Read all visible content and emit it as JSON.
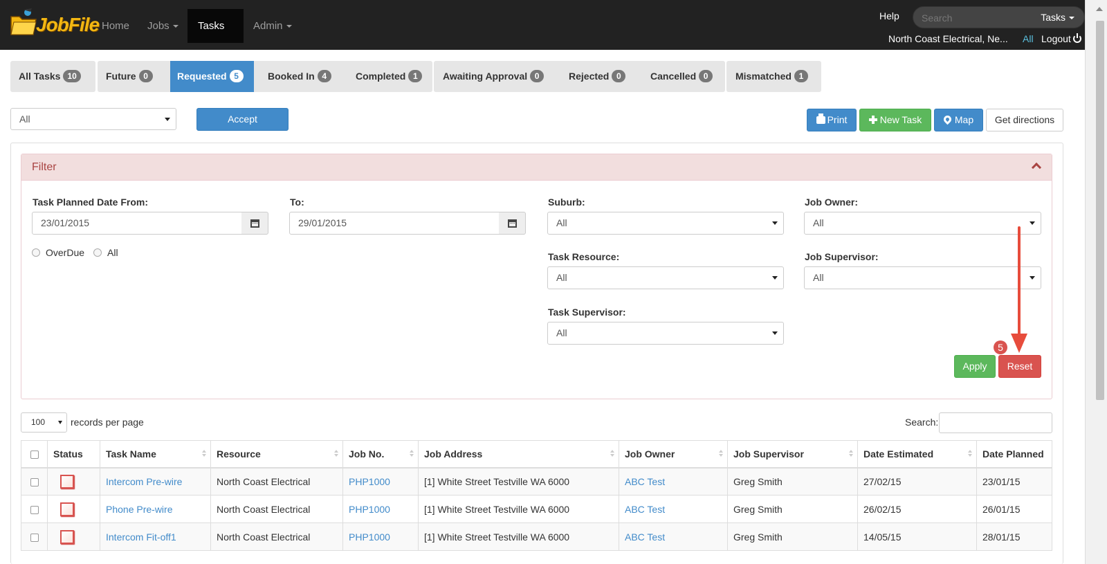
{
  "nav": {
    "brand": "JobFile",
    "items": [
      {
        "label": "Home"
      },
      {
        "label": "Jobs"
      },
      {
        "label": "Tasks"
      },
      {
        "label": "Admin"
      }
    ],
    "help": "Help",
    "search_placeholder": "Search",
    "search_scope": "Tasks",
    "company": "North Coast Electrical, Ne...",
    "all_link": "All",
    "logout": "Logout"
  },
  "tabs": [
    {
      "label": "All Tasks",
      "count": "10"
    },
    {
      "label": "Future",
      "count": "0"
    },
    {
      "label": "Requested",
      "count": "5",
      "active": true
    },
    {
      "label": "Booked In",
      "count": "4"
    },
    {
      "label": "Completed",
      "count": "1"
    },
    {
      "label": "Awaiting Approval",
      "count": "0"
    },
    {
      "label": "Rejected",
      "count": "0"
    },
    {
      "label": "Cancelled",
      "count": "0"
    },
    {
      "label": "Mismatched",
      "count": "1"
    }
  ],
  "actions": {
    "bulk_select": "All",
    "accept": "Accept",
    "print": "Print",
    "new_task": "New Task",
    "map": "Map",
    "directions": "Get directions"
  },
  "filter": {
    "title": "Filter",
    "date_from_label": "Task Planned Date From:",
    "date_from": "23/01/2015",
    "date_to_label": "To:",
    "date_to": "29/01/2015",
    "overdue": "OverDue",
    "all": "All",
    "suburb_label": "Suburb:",
    "suburb": "All",
    "job_owner_label": "Job Owner:",
    "job_owner": "All",
    "task_resource_label": "Task Resource:",
    "task_resource": "All",
    "job_supervisor_label": "Job Supervisor:",
    "job_supervisor": "All",
    "task_supervisor_label": "Task Supervisor:",
    "task_supervisor": "All",
    "apply": "Apply",
    "reset": "Reset",
    "step": "5"
  },
  "table": {
    "page_length": "100",
    "page_length_label": "records per page",
    "search_label": "Search:",
    "columns": [
      "Status",
      "Task Name",
      "Resource",
      "Job No.",
      "Job Address",
      "Job Owner",
      "Job Supervisor",
      "Date Estimated",
      "Date Planned"
    ],
    "rows": [
      {
        "task": "Intercom Pre-wire",
        "resource": "North Coast Electrical",
        "job_no": "PHP1000",
        "address": "[1] White Street Testville WA 6000",
        "owner": "ABC Test",
        "supervisor": "Greg Smith",
        "estimated": "27/02/15",
        "planned": "23/01/15"
      },
      {
        "task": "Phone Pre-wire",
        "resource": "North Coast Electrical",
        "job_no": "PHP1000",
        "address": "[1] White Street Testville WA 6000",
        "owner": "ABC Test",
        "supervisor": "Greg Smith",
        "estimated": "26/02/15",
        "planned": "26/01/15"
      },
      {
        "task": "Intercom Fit-off1",
        "resource": "North Coast Electrical",
        "job_no": "PHP1000",
        "address": "[1] White Street Testville WA 6000",
        "owner": "ABC Test",
        "supervisor": "Greg Smith",
        "estimated": "14/05/15",
        "planned": "28/01/15"
      }
    ]
  },
  "colors": {
    "navbar": "#222222",
    "primary": "#428bca",
    "success": "#5cb85c",
    "danger": "#d9534f",
    "annotation_arrow": "#e74c3c"
  }
}
